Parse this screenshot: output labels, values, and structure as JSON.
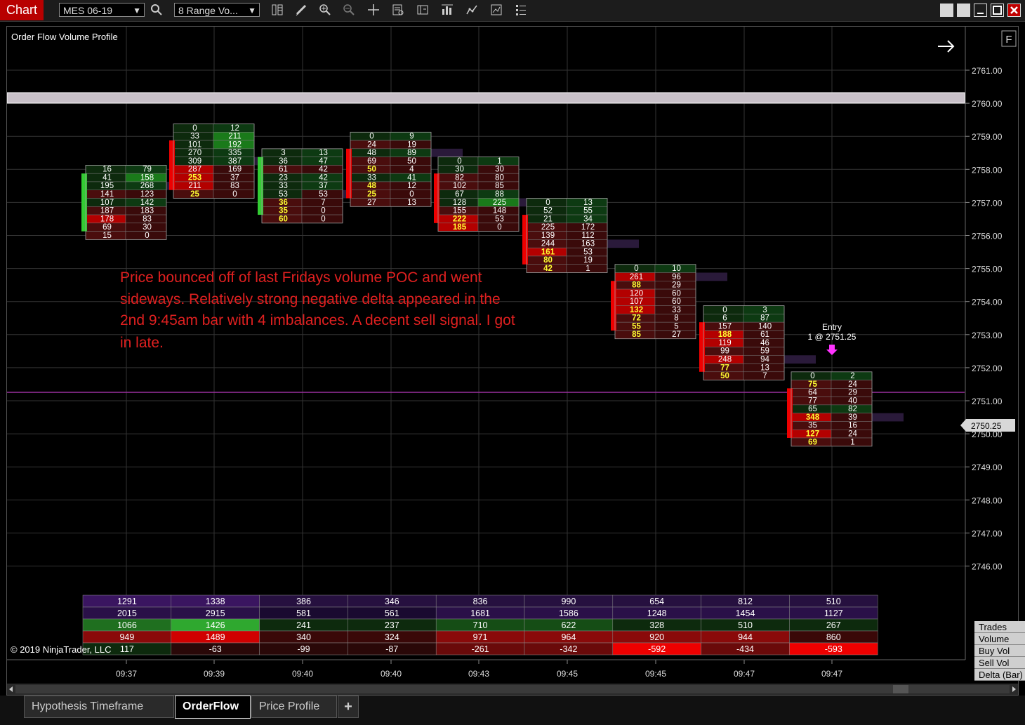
{
  "toolbar": {
    "chart_tab": "Chart",
    "instrument": "MES 06-19",
    "bar_type": "8 Range Vo...",
    "icons": [
      "search-icon",
      "data-series-icon",
      "drawing-tools-icon",
      "zoom-in-icon",
      "zoom-out-icon",
      "crosshair-icon",
      "properties-icon",
      "strategies-icon",
      "indicators-icon",
      "chart-trader-icon",
      "templates-icon",
      "list-icon"
    ]
  },
  "window": {
    "controls": [
      "restore",
      "tile",
      "minimize",
      "maximize",
      "close"
    ]
  },
  "chart": {
    "indicator_title": "Order Flow Volume Profile",
    "flag_button": "F",
    "copyright": "© 2019 NinjaTrader, LLC",
    "annotation": [
      "Price bounced off of last Fridays volume POC and went",
      "sideways. Relatively strong negative delta appeared in the",
      "2nd 9:45am bar with 4 imbalances. A decent sell signal. I got",
      "in late."
    ],
    "entry_label": "Entry",
    "entry_detail": "1 @ 2751.25",
    "current_price": "2750.25",
    "price_axis": [
      "2761.00",
      "2760.00",
      "2759.00",
      "2758.00",
      "2757.00",
      "2756.00",
      "2755.00",
      "2754.00",
      "2753.00",
      "2752.00",
      "2751.00",
      "2750.00",
      "2749.00",
      "2748.00",
      "2747.00",
      "2746.00"
    ],
    "time_axis": [
      "09:37",
      "09:39",
      "09:40",
      "09:40",
      "09:43",
      "09:45",
      "09:45",
      "09:47",
      "09:47"
    ],
    "colors": {
      "bid_strong": "#b30000",
      "ask_strong": "#1a7a1a",
      "imbalance": "#ffff33",
      "accent": "#b80000",
      "annotation": "#e02020",
      "level_line": "#9b30a0"
    }
  },
  "bars": [
    {
      "top": 2758.0,
      "high_bid_ask": [
        [
          16,
          79
        ],
        [
          41,
          158
        ],
        [
          195,
          268
        ],
        [
          141,
          123
        ],
        [
          107,
          142
        ],
        [
          187,
          183
        ],
        [
          178,
          83
        ],
        [
          69,
          30
        ],
        [
          15,
          0
        ]
      ],
      "delta_dir": "up"
    },
    {
      "top": 2759.25,
      "high_bid_ask": [
        [
          0,
          12
        ],
        [
          33,
          211
        ],
        [
          101,
          192
        ],
        [
          270,
          335
        ],
        [
          309,
          387
        ],
        [
          287,
          169
        ],
        [
          253,
          37
        ],
        [
          211,
          83
        ],
        [
          25,
          0
        ]
      ],
      "delta_dir": "down"
    },
    {
      "top": 2758.5,
      "high_bid_ask": [
        [
          3,
          13
        ],
        [
          36,
          47
        ],
        [
          61,
          42
        ],
        [
          23,
          42
        ],
        [
          33,
          37
        ],
        [
          53,
          53
        ],
        [
          36,
          7
        ],
        [
          35,
          0
        ],
        [
          60,
          0
        ]
      ],
      "delta_dir": "up"
    },
    {
      "top": 2759.0,
      "high_bid_ask": [
        [
          0,
          9
        ],
        [
          24,
          19
        ],
        [
          48,
          89
        ],
        [
          69,
          50
        ],
        [
          50,
          4
        ],
        [
          33,
          41
        ],
        [
          48,
          12
        ],
        [
          25,
          0
        ],
        [
          27,
          13
        ]
      ],
      "delta_dir": "down"
    },
    {
      "top": 2758.25,
      "high_bid_ask": [
        [
          0,
          1
        ],
        [
          30,
          30
        ],
        [
          82,
          80
        ],
        [
          102,
          85
        ],
        [
          67,
          88
        ],
        [
          128,
          225
        ],
        [
          155,
          148
        ],
        [
          222,
          53
        ],
        [
          185,
          0
        ]
      ],
      "delta_dir": "down"
    },
    {
      "top": 2757.0,
      "high_bid_ask": [
        [
          0,
          13
        ],
        [
          52,
          55
        ],
        [
          21,
          34
        ],
        [
          225,
          172
        ],
        [
          139,
          112
        ],
        [
          244,
          163
        ],
        [
          161,
          53
        ],
        [
          80,
          19
        ],
        [
          42,
          1
        ]
      ],
      "delta_dir": "down"
    },
    {
      "top": 2755.0,
      "high_bid_ask": [
        [
          0,
          10
        ],
        [
          261,
          96
        ],
        [
          88,
          29
        ],
        [
          120,
          60
        ],
        [
          107,
          60
        ],
        [
          132,
          33
        ],
        [
          72,
          8
        ],
        [
          55,
          5
        ],
        [
          85,
          27
        ]
      ],
      "delta_dir": "down"
    },
    {
      "top": 2753.75,
      "high_bid_ask": [
        [
          0,
          3
        ],
        [
          6,
          87
        ],
        [
          157,
          140
        ],
        [
          188,
          61
        ],
        [
          119,
          46
        ],
        [
          99,
          59
        ],
        [
          248,
          94
        ],
        [
          77,
          13
        ],
        [
          50,
          7
        ]
      ],
      "delta_dir": "down"
    },
    {
      "top": 2751.75,
      "high_bid_ask": [
        [
          0,
          2
        ],
        [
          75,
          24
        ],
        [
          64,
          29
        ],
        [
          77,
          40
        ],
        [
          65,
          82
        ],
        [
          348,
          39
        ],
        [
          35,
          16
        ],
        [
          127,
          24
        ],
        [
          69,
          1
        ]
      ],
      "delta_dir": "down"
    }
  ],
  "stats": {
    "labels": [
      "Trades",
      "Volume",
      "Buy Vol",
      "Sell Vol",
      "Delta (Bar)"
    ],
    "trades": [
      "1291",
      "1338",
      "386",
      "346",
      "836",
      "990",
      "654",
      "812",
      "510"
    ],
    "volume": [
      "2015",
      "2915",
      "581",
      "561",
      "1681",
      "1586",
      "1248",
      "1454",
      "1127"
    ],
    "buy_vol": [
      "1066",
      "1426",
      "241",
      "237",
      "710",
      "622",
      "328",
      "510",
      "267"
    ],
    "sell_vol": [
      "949",
      "1489",
      "340",
      "324",
      "971",
      "964",
      "920",
      "944",
      "860"
    ],
    "delta": [
      "117",
      "-63",
      "-99",
      "-87",
      "-261",
      "-342",
      "-592",
      "-434",
      "-593"
    ]
  },
  "tabs": [
    {
      "label": "Hypothesis Timeframe",
      "active": false
    },
    {
      "label": "OrderFlow",
      "active": true
    },
    {
      "label": "Price Profile",
      "active": false
    }
  ],
  "add_tab": "+"
}
